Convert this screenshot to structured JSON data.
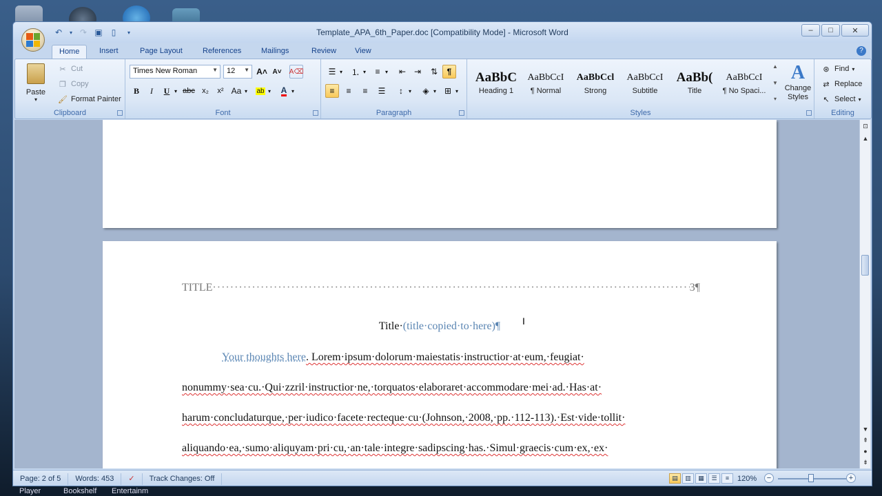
{
  "desktop": {
    "labels": [
      "Player",
      "Bookshelf",
      "Entertainm"
    ]
  },
  "window": {
    "title": "Template_APA_6th_Paper.doc [Compatibility Mode] - Microsoft Word",
    "controls": {
      "minimize": "–",
      "maximize": "□",
      "close": "✕"
    }
  },
  "ribbon": {
    "tabs": [
      "Home",
      "Insert",
      "Page Layout",
      "References",
      "Mailings",
      "Review",
      "View"
    ],
    "active_tab": "Home",
    "clipboard": {
      "label": "Clipboard",
      "paste": "Paste",
      "cut": "Cut",
      "copy": "Copy",
      "format_painter": "Format Painter"
    },
    "font": {
      "label": "Font",
      "font_name": "Times New Roman",
      "font_size": "12",
      "bold": "B",
      "italic": "I",
      "underline": "U",
      "strike": "abc",
      "subscript": "x₂",
      "superscript": "x²",
      "change_case": "Aa",
      "grow": "A˄",
      "shrink": "A˅"
    },
    "paragraph": {
      "label": "Paragraph",
      "pilcrow": "¶"
    },
    "styles": {
      "label": "Styles",
      "items": [
        {
          "sample": "AaBbC",
          "name": "Heading 1"
        },
        {
          "sample": "AaBbCcI",
          "name": "¶ Normal"
        },
        {
          "sample": "AaBbCcl",
          "name": "Strong"
        },
        {
          "sample": "AaBbCcI",
          "name": "Subtitle"
        },
        {
          "sample": "AaBb(",
          "name": "Title"
        },
        {
          "sample": "AaBbCcI",
          "name": "¶ No Spaci..."
        }
      ],
      "change_styles": "Change Styles"
    },
    "editing": {
      "label": "Editing",
      "find": "Find",
      "replace": "Replace",
      "select": "Select"
    }
  },
  "document": {
    "running_head": "TITLE",
    "page_number": "3¶",
    "title_prefix": "Title·",
    "title_placeholder": "(title·copied·to·here)¶",
    "thoughts_placeholder": "Your thoughts here",
    "body_lines": [
      ". Lorem·ipsum·dolorum·maiestatis·instructior·at·eum,·feugiat·",
      "nonummy·sea·cu.·Qui·zzril·instructior·ne,·torquatos·elaboraret·accommodare·mei·ad.·Has·at·",
      "harum·concludaturque,·per·iudico·facete·recteque·cu·(Johnson,·2008,·pp.·112-113).·Est·vide·tollit·",
      "aliquando·ea,·sumo·aliquyam·pri·cu,·an·tale·integre·sadipscing·has.·Simul·graecis·cum·ex,·ex·"
    ]
  },
  "status": {
    "page": "Page: 2 of 5",
    "words": "Words: 453",
    "track_changes": "Track Changes: Off",
    "zoom": "120%",
    "zoom_minus": "−",
    "zoom_plus": "+"
  },
  "colors": {
    "placeholder_blue": "#5b86b3",
    "ribbon_label": "#3e6aaa",
    "title_bar_text": "#1e395b"
  }
}
